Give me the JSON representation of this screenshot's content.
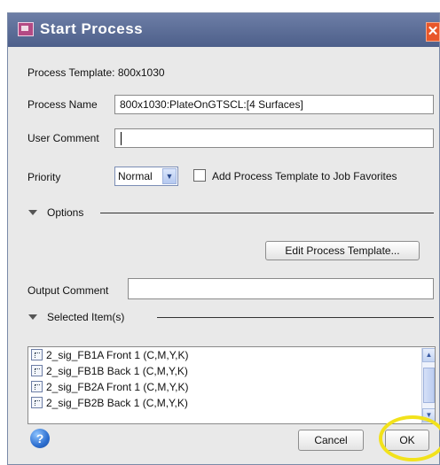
{
  "dialog": {
    "title": "Start Process",
    "close_glyph": "✕"
  },
  "form": {
    "template_label": "Process Template:",
    "template_value": "800x1030",
    "name_label": "Process Name",
    "name_value": "800x1030:PlateOnGTSCL:[4 Surfaces]",
    "comment_label": "User Comment",
    "comment_value": "",
    "priority_label": "Priority",
    "priority_value": "Normal",
    "favorites_label": "Add Process Template to Job Favorites",
    "favorites_checked": false
  },
  "options": {
    "label": "Options",
    "edit_button": "Edit Process Template...",
    "output_comment_label": "Output Comment",
    "output_comment_value": ""
  },
  "selected": {
    "label": "Selected Item(s)",
    "items": [
      "2_sig_FB1A Front 1 (C,M,Y,K)",
      "2_sig_FB1B Back 1 (C,M,Y,K)",
      "2_sig_FB2A Front 1 (C,M,Y,K)",
      "2_sig_FB2B Back 1 (C,M,Y,K)"
    ]
  },
  "buttons": {
    "cancel": "Cancel",
    "ok": "OK",
    "help_glyph": "?"
  },
  "icons": {
    "app": "process-icon",
    "item": "signature-icon",
    "help": "help-icon"
  },
  "colors": {
    "titlebar": "#5a6b94",
    "highlight_ring": "#f2e21b",
    "close": "#e8572a"
  }
}
